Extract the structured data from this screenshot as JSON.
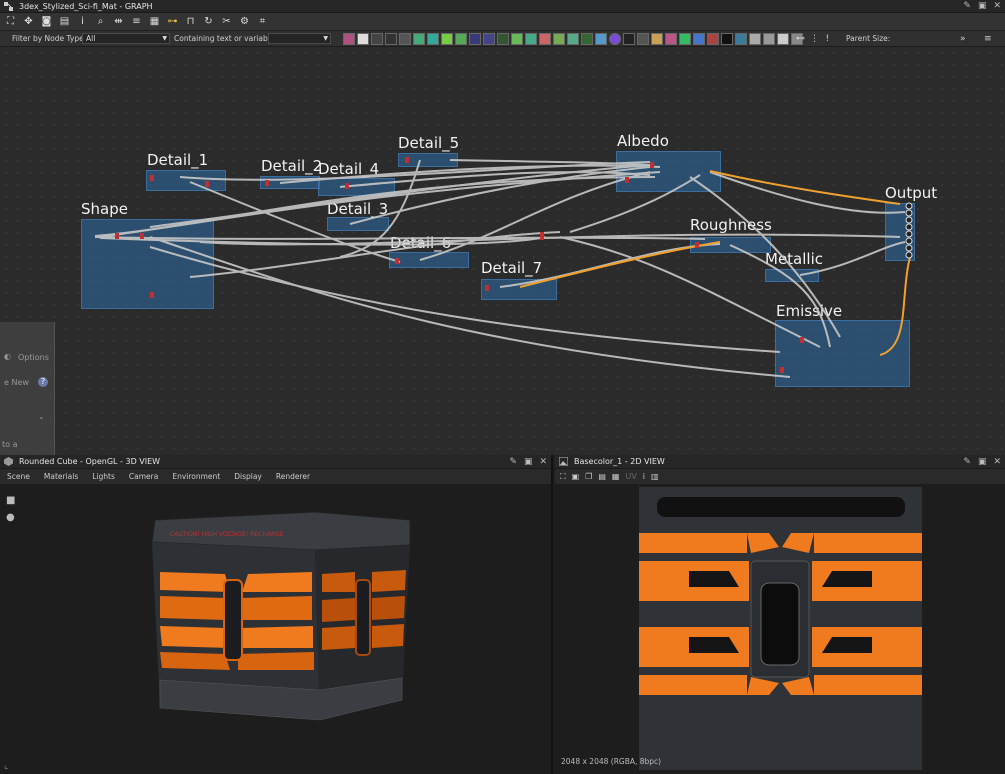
{
  "graph": {
    "title": "3dex_Stylized_Sci-fi_Mat - GRAPH",
    "filter_label": "Filter by Node Type",
    "filter_value": "All",
    "search_label": "Containing text or variable",
    "parent_size_label": "Parent Size:",
    "frames": [
      {
        "name": "Shape"
      },
      {
        "name": "Detail_1"
      },
      {
        "name": "Detail_2"
      },
      {
        "name": "Detail_4"
      },
      {
        "name": "Detail_3"
      },
      {
        "name": "Detail_5"
      },
      {
        "name": "Detail_6"
      },
      {
        "name": "Detail_7"
      },
      {
        "name": "Albedo"
      },
      {
        "name": "Roughness"
      },
      {
        "name": "Metallic"
      },
      {
        "name": "Emissive"
      },
      {
        "name": "Output"
      }
    ]
  },
  "ghost_panel": {
    "options": "Options",
    "new": "e New",
    "help": "?",
    "to_a": "to a"
  },
  "view3d": {
    "title": "Rounded Cube - OpenGL - 3D VIEW",
    "menu": [
      "Scene",
      "Materials",
      "Lights",
      "Camera",
      "Environment",
      "Display",
      "Renderer"
    ],
    "cube_text": "CAUTION! HIGH VOLTAGE! RECHARGE"
  },
  "view2d": {
    "title": "Basecolor_1 - 2D VIEW",
    "uv_label": "UV",
    "status": "2048 x 2048 (RGBA, 8bpc)"
  },
  "colors": {
    "frame_blue": "#2d6eaa",
    "orange": "#f07a1e",
    "wire": "#c8c8c8",
    "highlight_wire": "#f0a030"
  },
  "icons": [
    "pin-icon",
    "maximize-icon",
    "close-icon",
    "camera-icon",
    "settings-icon",
    "search-icon",
    "info-icon",
    "histogram-icon"
  ]
}
